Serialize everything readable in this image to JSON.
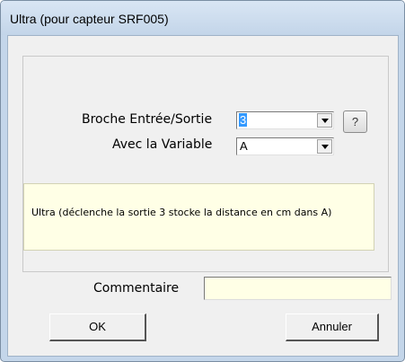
{
  "window": {
    "title": "Ultra (pour capteur SRF005)"
  },
  "form": {
    "pin_label": "Broche Entrée/Sortie",
    "pin_value": "3",
    "variable_label": "Avec la Variable",
    "variable_value": "A",
    "help_label": "?"
  },
  "info": {
    "text": "Ultra (déclenche la sortie 3 stocke la distance en cm dans A)"
  },
  "comment": {
    "label": "Commentaire",
    "value": ""
  },
  "buttons": {
    "ok": "OK",
    "cancel": "Annuler"
  }
}
